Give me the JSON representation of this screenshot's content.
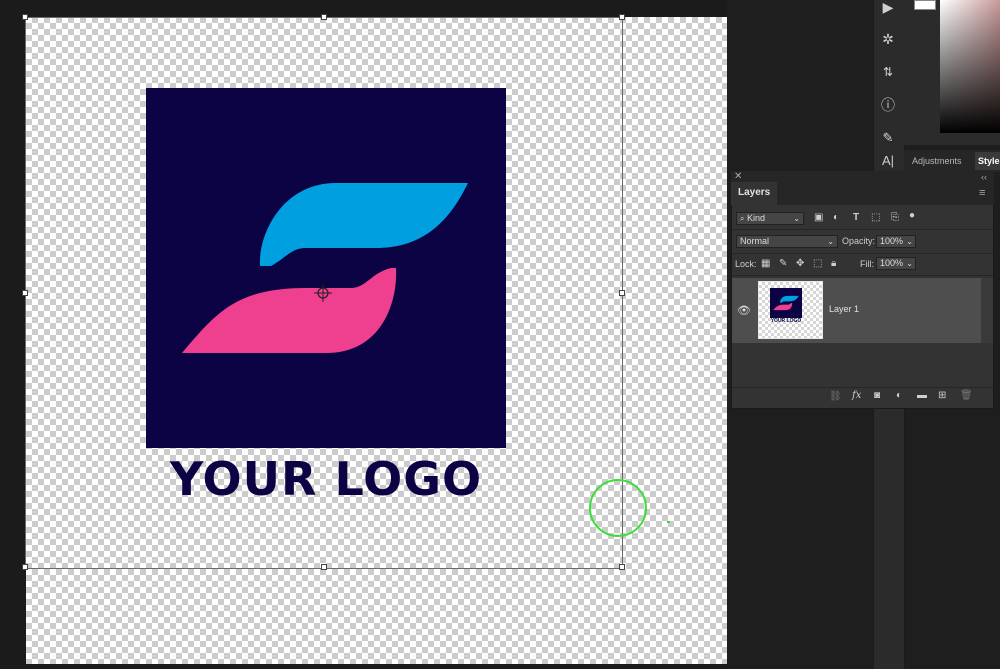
{
  "colors": {
    "navy": "#0b0343",
    "blue": "#009fe0",
    "pink": "#ef3f8f",
    "selection_green": "#38e038"
  },
  "canvas": {
    "logo_text": "YOUR LOGO"
  },
  "tools": [
    "play-icon",
    "3d-axis-icon",
    "sample-icon",
    "info-icon",
    "brush-icon",
    "type-icon"
  ],
  "adjustments_panel": {
    "tabs": [
      "Adjustments",
      "Styles"
    ]
  },
  "layers_panel": {
    "tab": "Layers",
    "filter_kind": "Kind",
    "blend_mode": "Normal",
    "opacity_label": "Opacity:",
    "opacity_value": "100%",
    "lock_label": "Lock:",
    "fill_label": "Fill:",
    "fill_value": "100%",
    "layers": [
      {
        "name": "Layer 1",
        "thumb_text": "YOUR LOGO",
        "visible": true
      }
    ]
  }
}
